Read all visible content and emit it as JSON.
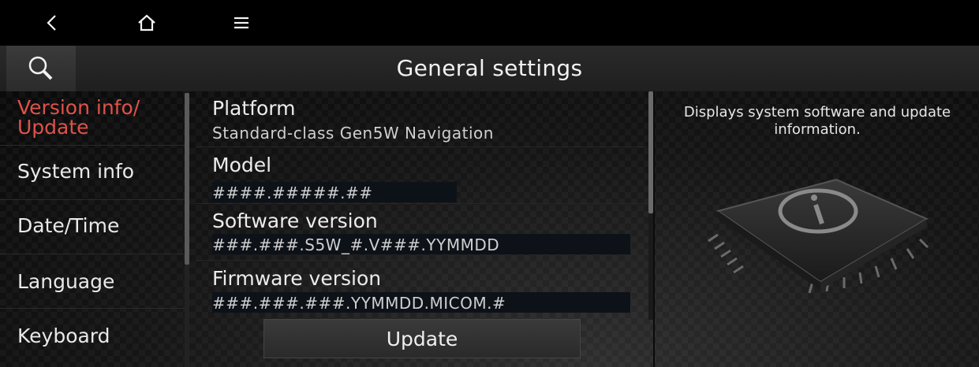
{
  "topbar": {
    "back_icon": "back-icon",
    "home_icon": "home-icon",
    "menu_icon": "menu-icon"
  },
  "header": {
    "title": "General settings",
    "search_icon": "search-icon"
  },
  "sidebar": {
    "items": [
      {
        "label": "Version info/ Update",
        "active": true
      },
      {
        "label": "System info"
      },
      {
        "label": "Date/Time"
      },
      {
        "label": "Language"
      },
      {
        "label": "Keyboard"
      }
    ]
  },
  "main": {
    "rows": [
      {
        "label": "Platform",
        "value": "Standard-class Gen5W Navigation"
      },
      {
        "label": "Model",
        "value": "####.#####.##"
      },
      {
        "label": "Software version",
        "value": "###.###.S5W_#.V###.YYMMDD"
      },
      {
        "label": "Firmware version",
        "value": "###.###.###.YYMMDD.MICOM.#"
      }
    ],
    "update_label": "Update"
  },
  "description": "Displays system software and update information.",
  "colors": {
    "accent": "#e0524a",
    "background": "#000000"
  }
}
